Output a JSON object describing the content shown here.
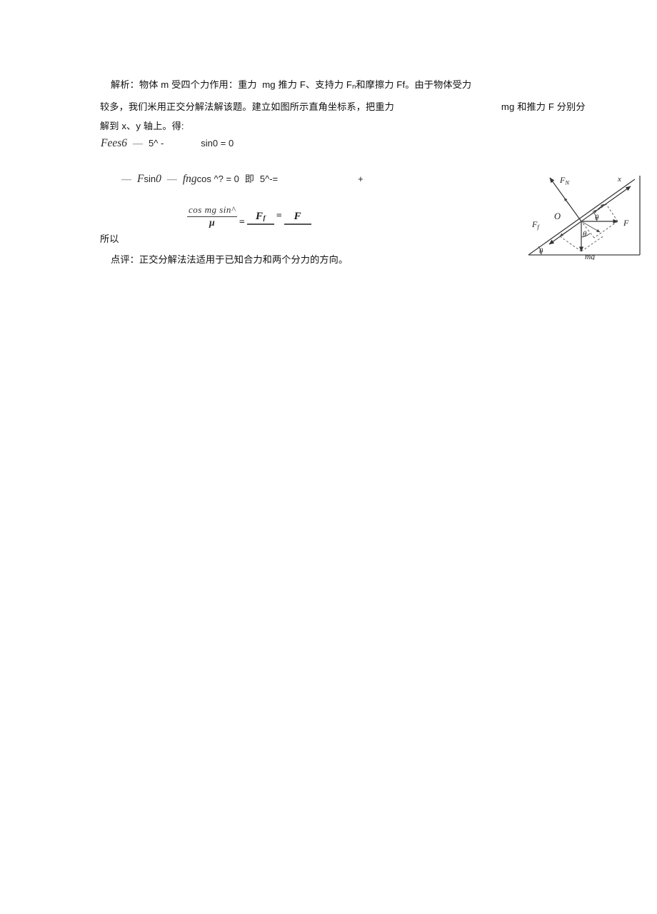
{
  "document": {
    "paragraphs": [
      {
        "id": "analysis-line-1",
        "text": "    解析：物体 m 受四个力作用：重力  mg 推力 F、支持力 F",
        "sub": "n",
        "text_after": "和摩擦力 Ff。由于物体受力"
      },
      {
        "id": "analysis-line-2",
        "text_before": "较多，我们米用正交分解法解该题。建立如图所示直角坐标系，把重力",
        "text_after": "mg 和推力 F 分别分"
      },
      {
        "id": "analysis-line-3",
        "text": "解到 x、y 轴上。得:"
      }
    ],
    "equations": {
      "eq1": {
        "lead": "Fees6",
        "dash": "—",
        "mid": "5^ -",
        "tail": "sin0 = 0"
      },
      "eq2": {
        "dash1": "—",
        "t1": "F",
        "t2": "sin",
        "t3": "0",
        "dash2": "—",
        "t4": "fng",
        "t5": "cos ^? = 0",
        "t6": "即",
        "t7": "5^-=",
        "plus": "+"
      },
      "eq3": {
        "frac1_num": "cos mg sin^",
        "frac1_den": "μ",
        "op1": "=",
        "frac2_num": "F",
        "frac2_sub": "f",
        "op2": "=",
        "frac3_num": "F"
      }
    },
    "so_label": "所以",
    "comment_line": "    点评：正交分解法法适用于已知合力和两个分力的方向。"
  },
  "figure": {
    "name": "inclined-plane-force-diagram",
    "labels": {
      "normal_force": "F",
      "normal_force_sub": "N",
      "friction_force": "F",
      "friction_force_sub": "f",
      "applied_force": "F",
      "weight": "mg",
      "origin": "O",
      "x_axis": "x",
      "angle_incline": "θ",
      "angle_upper": "θ",
      "angle_lower": "θ"
    },
    "colors": {
      "stroke": "#3a3a3a",
      "dashed": "#5a5a5a"
    }
  }
}
